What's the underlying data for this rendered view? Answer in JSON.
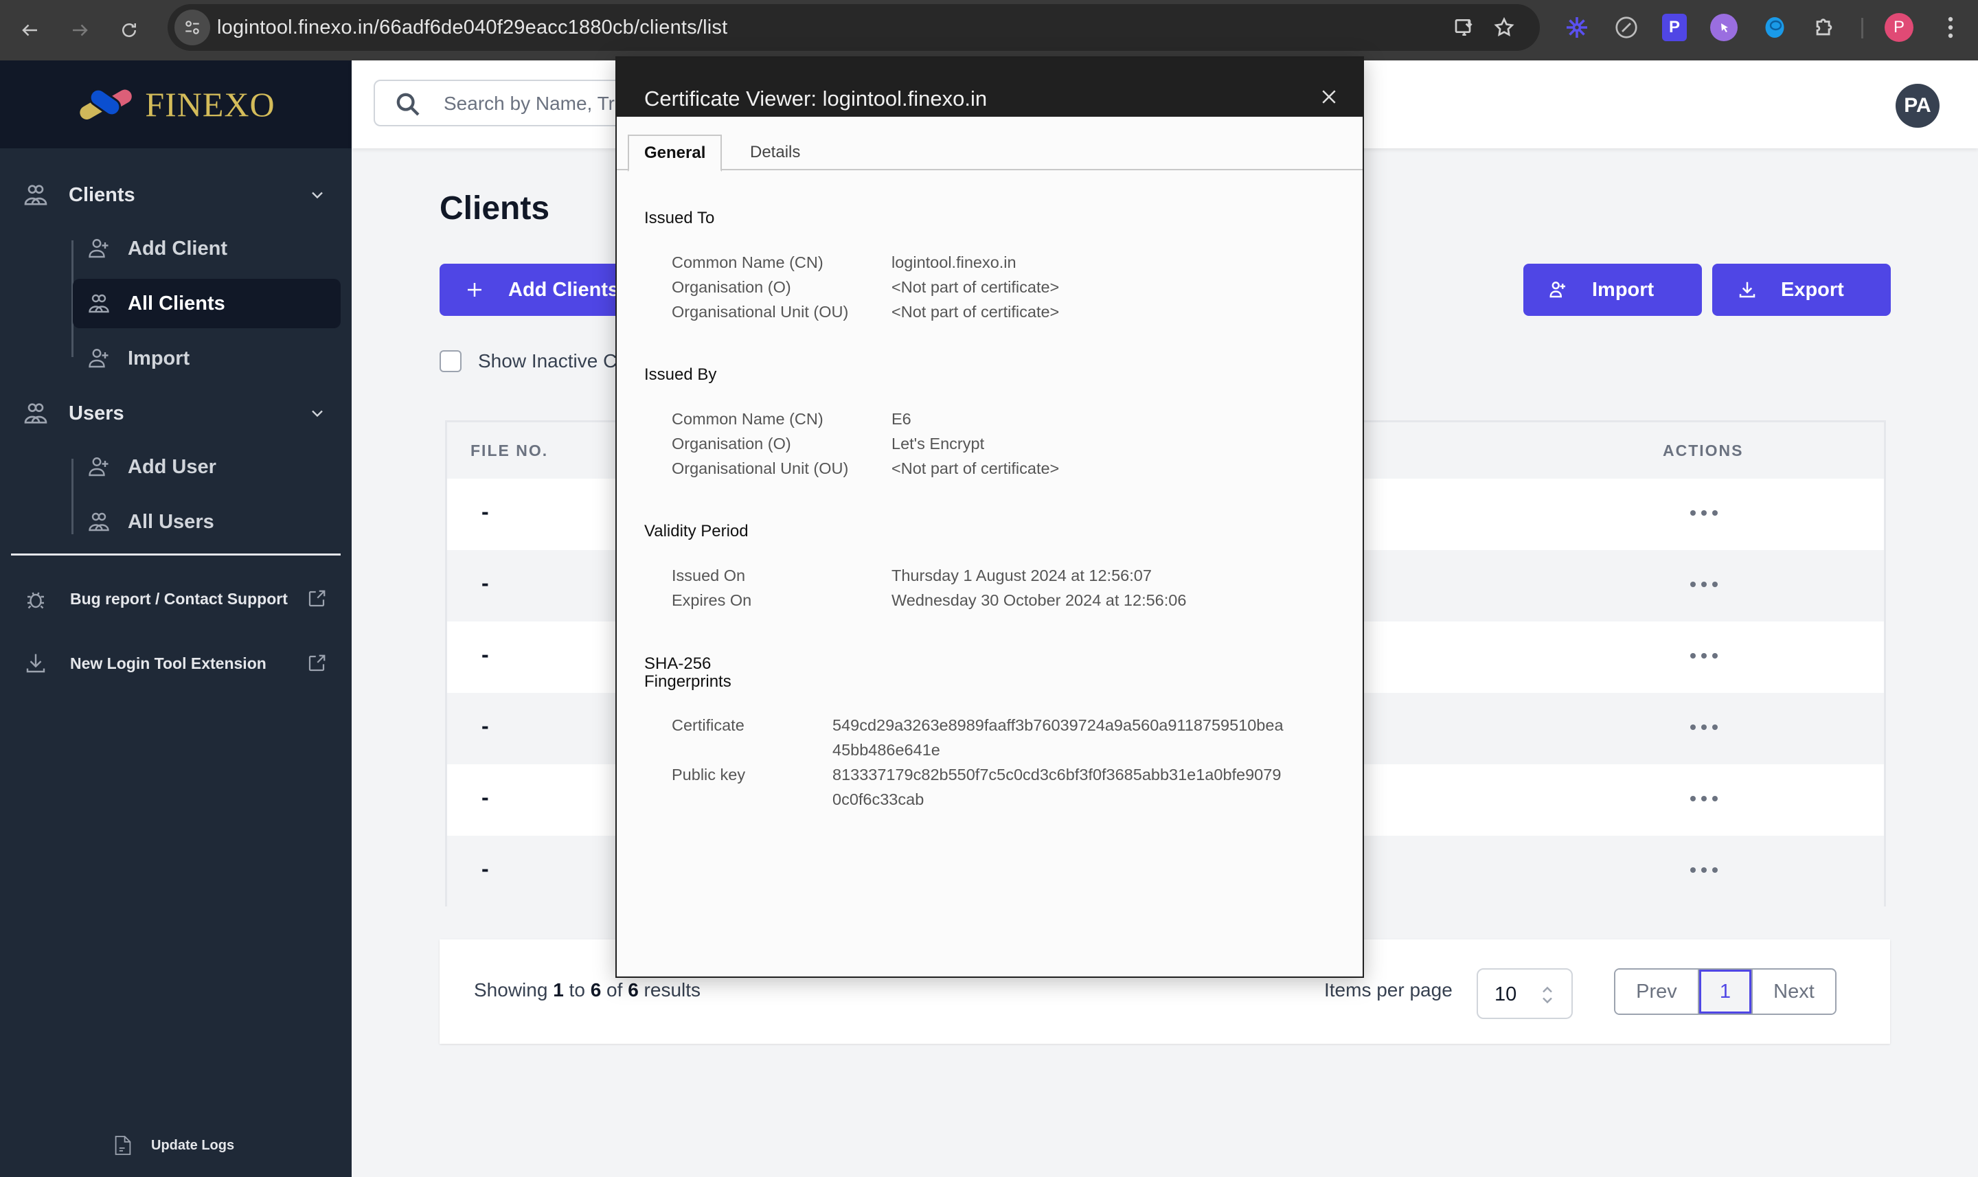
{
  "browser": {
    "url": "logintool.finexo.in/66adf6de040f29eacc1880cb/clients/list",
    "profile_initial": "P",
    "extensions": [
      "snowflake-extension",
      "compass-extension",
      "p-extension",
      "cursor-click-extension",
      "blue-shell-extension",
      "puzzle-extensions"
    ],
    "colors": {
      "profile": "#e04a75",
      "p_ext": "#5046e5",
      "cursor_ext": "#9a6ee0",
      "snowflake": "#5a50f0",
      "shell": "#1a9ae8"
    }
  },
  "sidebar": {
    "logo_text": "FINEXO",
    "groups": [
      {
        "label": "Clients",
        "items": [
          {
            "label": "Add Client",
            "icon": "user-plus-icon"
          },
          {
            "label": "All Clients",
            "icon": "users-icon",
            "active": true
          },
          {
            "label": "Import",
            "icon": "user-plus-icon"
          }
        ]
      },
      {
        "label": "Users",
        "items": [
          {
            "label": "Add User",
            "icon": "user-plus-icon"
          },
          {
            "label": "All Users",
            "icon": "users-icon"
          }
        ]
      }
    ],
    "links": [
      {
        "label": "Bug report / Contact Support",
        "icon": "bug-icon"
      },
      {
        "label": "New Login Tool Extension",
        "icon": "download-icon"
      }
    ],
    "footer_link": "Update Logs"
  },
  "topbar": {
    "search_placeholder": "Search by Name, Trade Name, PAN, GSTIN...",
    "avatar_initials": "PA"
  },
  "page": {
    "title": "Clients",
    "add_button": "Add Clients",
    "import_button": "Import",
    "export_button": "Export",
    "show_inactive_label": "Show Inactive Clients",
    "table": {
      "columns": [
        "FILE NO.",
        "ACTIONS"
      ],
      "rows": [
        {
          "file_no": "-"
        },
        {
          "file_no": "-"
        },
        {
          "file_no": "-"
        },
        {
          "file_no": "-"
        },
        {
          "file_no": "-"
        },
        {
          "file_no": "-"
        }
      ]
    },
    "pagination": {
      "showing_prefix": "Showing",
      "from": "1",
      "to_word": "to",
      "to": "6",
      "of_word": "of",
      "total": "6",
      "suffix": "results",
      "items_per_page_label": "Items per page",
      "items_per_page": "10",
      "prev": "Prev",
      "current_page": "1",
      "next": "Next"
    },
    "accent_color": "#4f46e5"
  },
  "cert_viewer": {
    "title": "Certificate Viewer: logintool.finexo.in",
    "tabs": [
      "General",
      "Details"
    ],
    "active_tab": "General",
    "issued_to": {
      "heading": "Issued To",
      "rows": [
        {
          "key": "Common Name (CN)",
          "value": "logintool.finexo.in"
        },
        {
          "key": "Organisation (O)",
          "value": "<Not part of certificate>"
        },
        {
          "key": "Organisational Unit (OU)",
          "value": "<Not part of certificate>"
        }
      ]
    },
    "issued_by": {
      "heading": "Issued By",
      "rows": [
        {
          "key": "Common Name (CN)",
          "value": "E6"
        },
        {
          "key": "Organisation (O)",
          "value": "Let's Encrypt"
        },
        {
          "key": "Organisational Unit (OU)",
          "value": "<Not part of certificate>"
        }
      ]
    },
    "validity": {
      "heading": "Validity Period",
      "rows": [
        {
          "key": "Issued On",
          "value": "Thursday 1 August 2024 at 12:56:07"
        },
        {
          "key": "Expires On",
          "value": "Wednesday 30 October 2024 at 12:56:06"
        }
      ]
    },
    "fingerprints": {
      "heading_line1": "SHA-256",
      "heading_line2": "Fingerprints",
      "certificate_label": "Certificate",
      "certificate_line1": "549cd29a3263e8989faaff3b76039724a9a560a9118759510bea",
      "certificate_line2": "45bb486e641e",
      "public_key_label": "Public key",
      "public_key_line1": "813337179c82b550f7c5c0cd3c6bf3f0f3685abb31e1a0bfe9079",
      "public_key_line2": "0c0f6c33cab"
    }
  }
}
